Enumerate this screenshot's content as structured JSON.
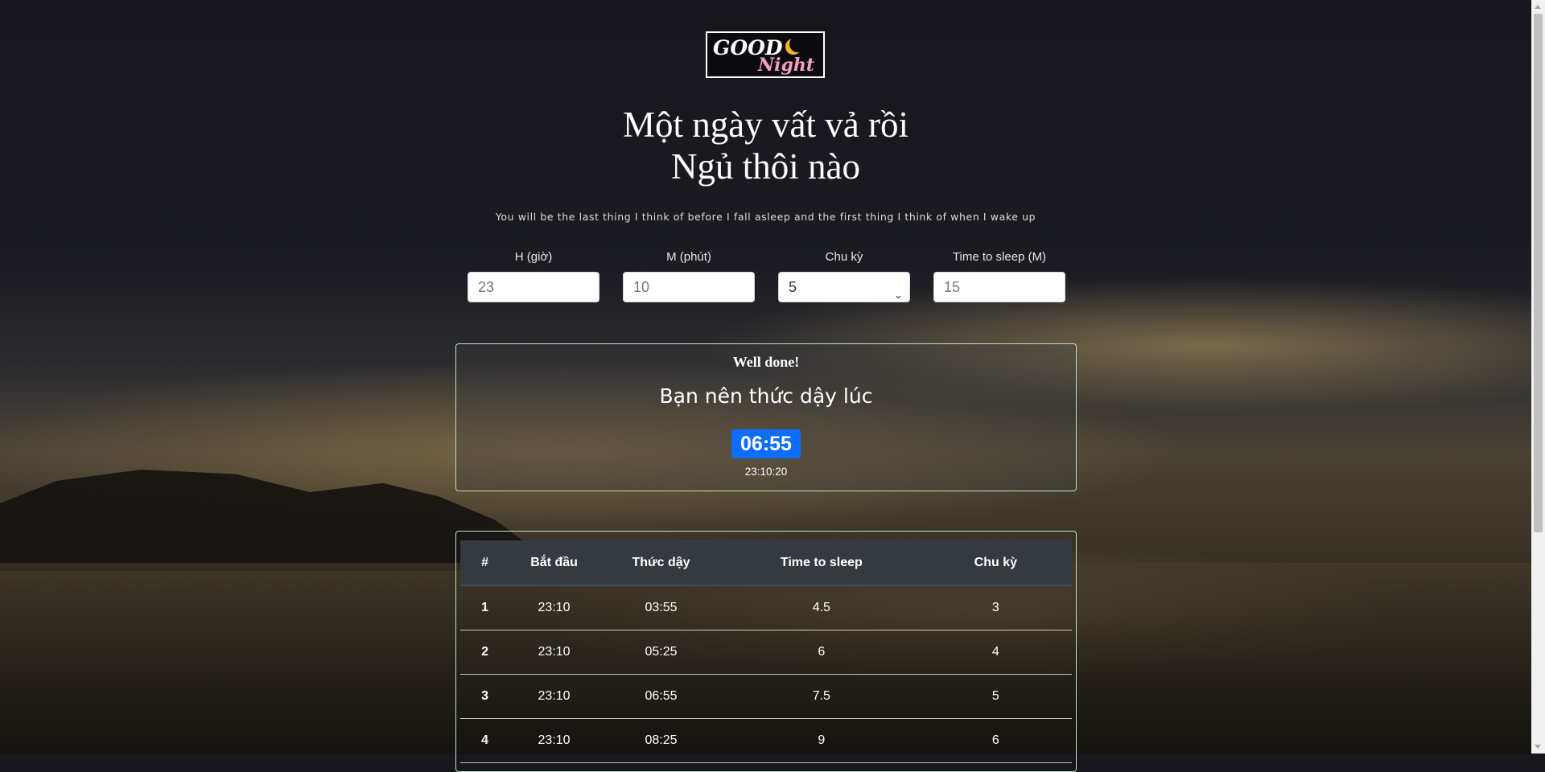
{
  "logo": {
    "line1": "GOOD",
    "line2": "Night"
  },
  "heading": {
    "line1": "Một ngày vất vả rồi",
    "line2": "Ngủ thôi nào"
  },
  "quote": "You will be the last thing I think of before I fall asleep and the first thing I think of when I wake up",
  "form": {
    "hour": {
      "label": "H (giờ)",
      "value": "23"
    },
    "minute": {
      "label": "M (phút)",
      "value": "10"
    },
    "cycle": {
      "label": "Chu kỳ",
      "value": "5"
    },
    "time_to_sleep": {
      "label": "Time to sleep (M)",
      "value": "15"
    }
  },
  "result": {
    "title": "Well done!",
    "message": "Bạn nên thức dậy lúc",
    "wake_time": "06:55",
    "current_time": "23:10:20"
  },
  "table": {
    "headers": [
      "#",
      "Bắt đầu",
      "Thức dậy",
      "Time to sleep",
      "Chu kỳ"
    ],
    "rows": [
      [
        "1",
        "23:10",
        "03:55",
        "4.5",
        "3"
      ],
      [
        "2",
        "23:10",
        "05:25",
        "6",
        "4"
      ],
      [
        "3",
        "23:10",
        "06:55",
        "7.5",
        "5"
      ],
      [
        "4",
        "23:10",
        "08:25",
        "9",
        "6"
      ]
    ]
  }
}
